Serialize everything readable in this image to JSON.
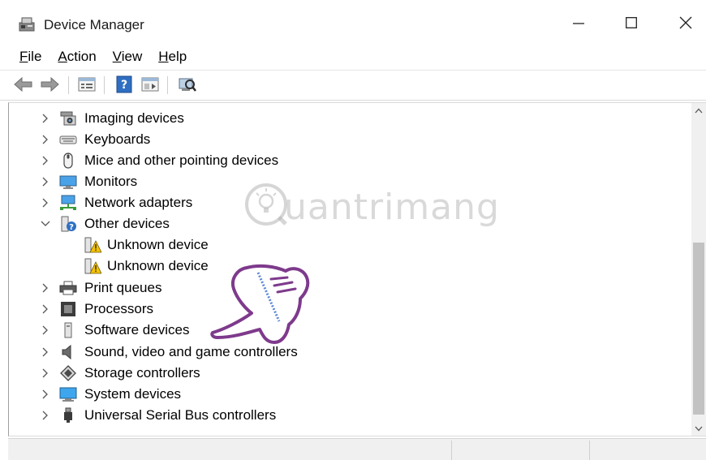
{
  "window": {
    "title": "Device Manager",
    "controls": {
      "minimize": "minimize-icon",
      "maximize": "maximize-icon",
      "close": "close-icon"
    }
  },
  "menu": {
    "items": [
      {
        "label": "File",
        "mnemonic": "F",
        "rest": "ile"
      },
      {
        "label": "Action",
        "mnemonic": "A",
        "rest": "ction"
      },
      {
        "label": "View",
        "mnemonic": "V",
        "rest": "iew"
      },
      {
        "label": "Help",
        "mnemonic": "H",
        "rest": "elp"
      }
    ]
  },
  "toolbar": {
    "buttons": [
      "back-icon",
      "forward-icon",
      "properties-icon",
      "help-icon",
      "view-icon",
      "scan-hardware-icon"
    ]
  },
  "tree": {
    "nodes": [
      {
        "label": "Imaging devices",
        "expanded": false,
        "icon": "camera-icon"
      },
      {
        "label": "Keyboards",
        "expanded": false,
        "icon": "keyboard-icon"
      },
      {
        "label": "Mice and other pointing devices",
        "expanded": false,
        "icon": "mouse-icon"
      },
      {
        "label": "Monitors",
        "expanded": false,
        "icon": "monitor-icon"
      },
      {
        "label": "Network adapters",
        "expanded": false,
        "icon": "network-icon"
      },
      {
        "label": "Other devices",
        "expanded": true,
        "icon": "unknown-device-icon",
        "children": [
          {
            "label": "Unknown device",
            "icon": "warning-device-icon"
          },
          {
            "label": "Unknown device",
            "icon": "warning-device-icon"
          }
        ]
      },
      {
        "label": "Print queues",
        "expanded": false,
        "icon": "printer-icon"
      },
      {
        "label": "Processors",
        "expanded": false,
        "icon": "processor-icon"
      },
      {
        "label": "Software devices",
        "expanded": false,
        "icon": "software-device-icon"
      },
      {
        "label": "Sound, video and game controllers",
        "expanded": false,
        "icon": "speaker-icon"
      },
      {
        "label": "Storage controllers",
        "expanded": false,
        "icon": "storage-icon"
      },
      {
        "label": "System devices",
        "expanded": false,
        "icon": "system-icon"
      },
      {
        "label": "Universal Serial Bus controllers",
        "expanded": false,
        "icon": "usb-icon"
      }
    ]
  },
  "scrollbar": {
    "position": 0.72
  },
  "watermark": {
    "text": "uantrimang",
    "logo": "quantrimang-logo"
  },
  "overlay": {
    "icon": "pointing-hand-icon"
  },
  "colors": {
    "accent": "#0078d7",
    "warning": "#f5c400",
    "selection": "#cce8ff"
  }
}
